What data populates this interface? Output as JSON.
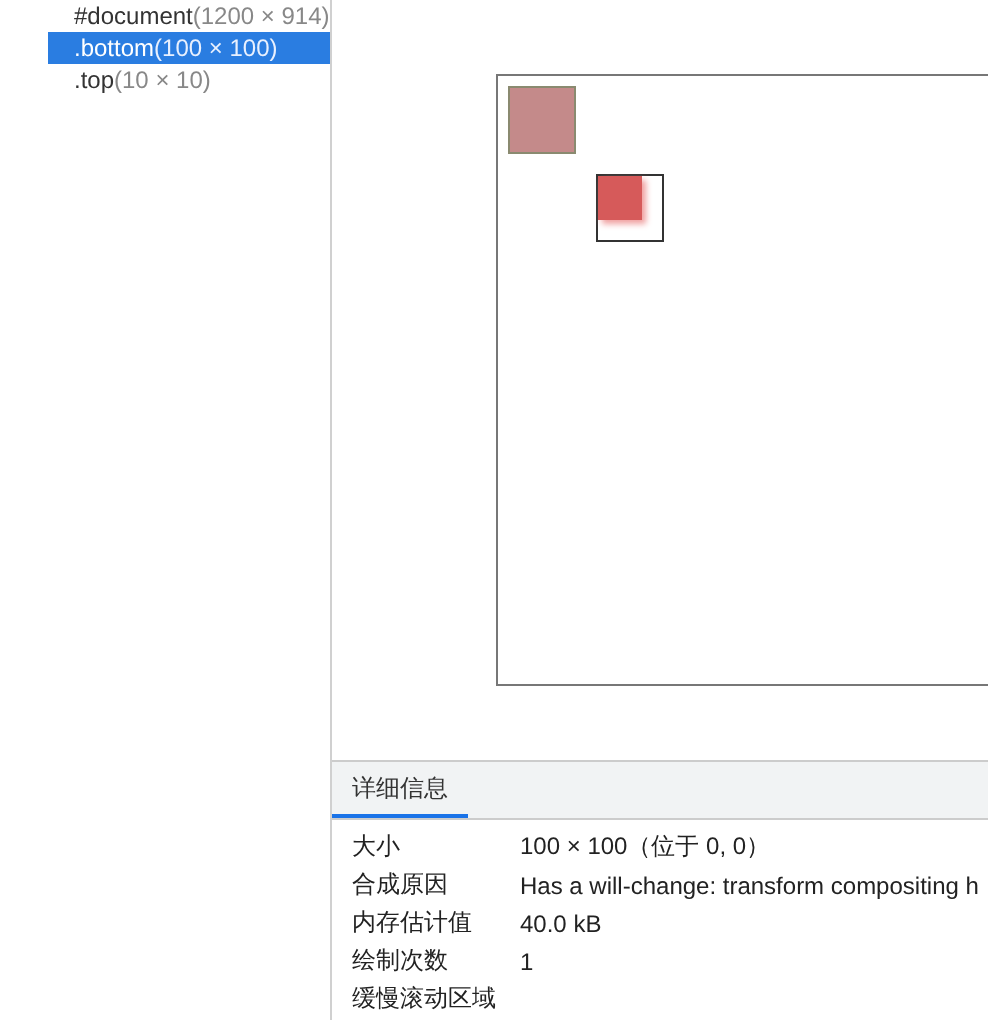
{
  "layers": [
    {
      "name": "#document",
      "size": "(1200 × 914)",
      "selected": false
    },
    {
      "name": ".bottom",
      "size": "(100 × 100)",
      "selected": true
    },
    {
      "name": ".top",
      "size": "(10 × 10)",
      "selected": false
    }
  ],
  "details": {
    "tabs": [
      {
        "label": "详细信息",
        "selected": true
      }
    ],
    "rows": [
      {
        "label": "大小",
        "value": "100 × 100（位于 0, 0）"
      },
      {
        "label": "合成原因",
        "value": "Has a will-change: transform compositing h"
      },
      {
        "label": "内存估计值",
        "value": "40.0 kB"
      },
      {
        "label": "绘制次数",
        "value": "1"
      },
      {
        "label": "缓慢滚动区域"
      }
    ]
  }
}
